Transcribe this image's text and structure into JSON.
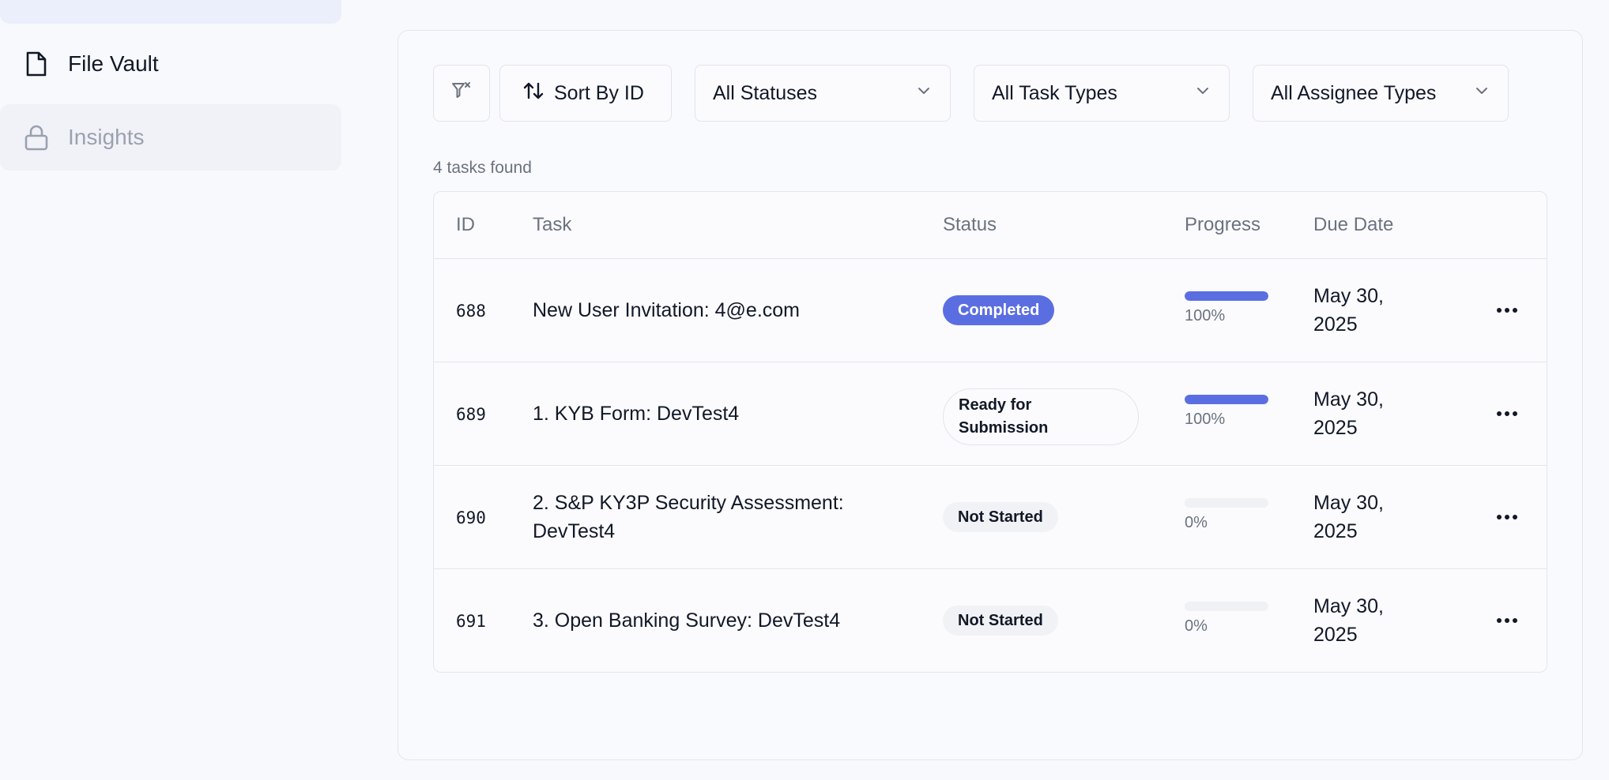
{
  "sidebar": {
    "items": [
      {
        "label": "File Vault",
        "icon": "file-icon",
        "locked": false
      },
      {
        "label": "Insights",
        "icon": "lock-icon",
        "locked": true
      }
    ]
  },
  "toolbar": {
    "sort_label": "Sort By ID",
    "status_select": "All Statuses",
    "task_type_select": "All Task Types",
    "assignee_type_select": "All Assignee Types"
  },
  "summary": {
    "count_text": "4 tasks found"
  },
  "table": {
    "headers": {
      "id": "ID",
      "task": "Task",
      "status": "Status",
      "progress": "Progress",
      "due": "Due Date"
    },
    "rows": [
      {
        "id": "688",
        "task": "New User Invitation: 4@e.com",
        "status": "Completed",
        "status_kind": "completed",
        "progress": 100,
        "progress_label": "100%",
        "due_line1": "May 30,",
        "due_line2": "2025"
      },
      {
        "id": "689",
        "task": "1. KYB Form: DevTest4",
        "status": "Ready for Submission",
        "status_kind": "ready",
        "progress": 100,
        "progress_label": "100%",
        "due_line1": "May 30,",
        "due_line2": "2025"
      },
      {
        "id": "690",
        "task": "2. S&P KY3P Security Assessment: DevTest4",
        "status": "Not Started",
        "status_kind": "notstarted",
        "progress": 0,
        "progress_label": "0%",
        "due_line1": "May 30,",
        "due_line2": "2025"
      },
      {
        "id": "691",
        "task": "3. Open Banking Survey: DevTest4",
        "status": "Not Started",
        "status_kind": "notstarted",
        "progress": 0,
        "progress_label": "0%",
        "due_line1": "May 30,",
        "due_line2": "2025"
      }
    ]
  },
  "colors": {
    "accent": "#5b6ee1",
    "muted_text": "#6b7280",
    "border": "#e3e6ee"
  }
}
